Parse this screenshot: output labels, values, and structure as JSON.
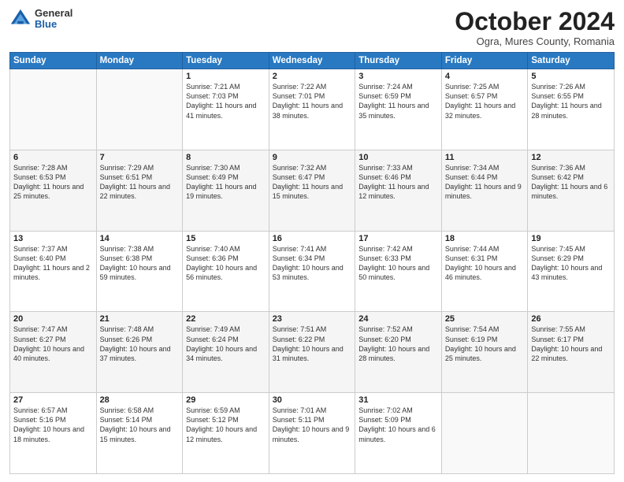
{
  "header": {
    "logo_general": "General",
    "logo_blue": "Blue",
    "month_title": "October 2024",
    "location": "Ogra, Mures County, Romania"
  },
  "days_of_week": [
    "Sunday",
    "Monday",
    "Tuesday",
    "Wednesday",
    "Thursday",
    "Friday",
    "Saturday"
  ],
  "weeks": [
    [
      {
        "day": "",
        "sunrise": "",
        "sunset": "",
        "daylight": ""
      },
      {
        "day": "",
        "sunrise": "",
        "sunset": "",
        "daylight": ""
      },
      {
        "day": "1",
        "sunrise": "Sunrise: 7:21 AM",
        "sunset": "Sunset: 7:03 PM",
        "daylight": "Daylight: 11 hours and 41 minutes."
      },
      {
        "day": "2",
        "sunrise": "Sunrise: 7:22 AM",
        "sunset": "Sunset: 7:01 PM",
        "daylight": "Daylight: 11 hours and 38 minutes."
      },
      {
        "day": "3",
        "sunrise": "Sunrise: 7:24 AM",
        "sunset": "Sunset: 6:59 PM",
        "daylight": "Daylight: 11 hours and 35 minutes."
      },
      {
        "day": "4",
        "sunrise": "Sunrise: 7:25 AM",
        "sunset": "Sunset: 6:57 PM",
        "daylight": "Daylight: 11 hours and 32 minutes."
      },
      {
        "day": "5",
        "sunrise": "Sunrise: 7:26 AM",
        "sunset": "Sunset: 6:55 PM",
        "daylight": "Daylight: 11 hours and 28 minutes."
      }
    ],
    [
      {
        "day": "6",
        "sunrise": "Sunrise: 7:28 AM",
        "sunset": "Sunset: 6:53 PM",
        "daylight": "Daylight: 11 hours and 25 minutes."
      },
      {
        "day": "7",
        "sunrise": "Sunrise: 7:29 AM",
        "sunset": "Sunset: 6:51 PM",
        "daylight": "Daylight: 11 hours and 22 minutes."
      },
      {
        "day": "8",
        "sunrise": "Sunrise: 7:30 AM",
        "sunset": "Sunset: 6:49 PM",
        "daylight": "Daylight: 11 hours and 19 minutes."
      },
      {
        "day": "9",
        "sunrise": "Sunrise: 7:32 AM",
        "sunset": "Sunset: 6:47 PM",
        "daylight": "Daylight: 11 hours and 15 minutes."
      },
      {
        "day": "10",
        "sunrise": "Sunrise: 7:33 AM",
        "sunset": "Sunset: 6:46 PM",
        "daylight": "Daylight: 11 hours and 12 minutes."
      },
      {
        "day": "11",
        "sunrise": "Sunrise: 7:34 AM",
        "sunset": "Sunset: 6:44 PM",
        "daylight": "Daylight: 11 hours and 9 minutes."
      },
      {
        "day": "12",
        "sunrise": "Sunrise: 7:36 AM",
        "sunset": "Sunset: 6:42 PM",
        "daylight": "Daylight: 11 hours and 6 minutes."
      }
    ],
    [
      {
        "day": "13",
        "sunrise": "Sunrise: 7:37 AM",
        "sunset": "Sunset: 6:40 PM",
        "daylight": "Daylight: 11 hours and 2 minutes."
      },
      {
        "day": "14",
        "sunrise": "Sunrise: 7:38 AM",
        "sunset": "Sunset: 6:38 PM",
        "daylight": "Daylight: 10 hours and 59 minutes."
      },
      {
        "day": "15",
        "sunrise": "Sunrise: 7:40 AM",
        "sunset": "Sunset: 6:36 PM",
        "daylight": "Daylight: 10 hours and 56 minutes."
      },
      {
        "day": "16",
        "sunrise": "Sunrise: 7:41 AM",
        "sunset": "Sunset: 6:34 PM",
        "daylight": "Daylight: 10 hours and 53 minutes."
      },
      {
        "day": "17",
        "sunrise": "Sunrise: 7:42 AM",
        "sunset": "Sunset: 6:33 PM",
        "daylight": "Daylight: 10 hours and 50 minutes."
      },
      {
        "day": "18",
        "sunrise": "Sunrise: 7:44 AM",
        "sunset": "Sunset: 6:31 PM",
        "daylight": "Daylight: 10 hours and 46 minutes."
      },
      {
        "day": "19",
        "sunrise": "Sunrise: 7:45 AM",
        "sunset": "Sunset: 6:29 PM",
        "daylight": "Daylight: 10 hours and 43 minutes."
      }
    ],
    [
      {
        "day": "20",
        "sunrise": "Sunrise: 7:47 AM",
        "sunset": "Sunset: 6:27 PM",
        "daylight": "Daylight: 10 hours and 40 minutes."
      },
      {
        "day": "21",
        "sunrise": "Sunrise: 7:48 AM",
        "sunset": "Sunset: 6:26 PM",
        "daylight": "Daylight: 10 hours and 37 minutes."
      },
      {
        "day": "22",
        "sunrise": "Sunrise: 7:49 AM",
        "sunset": "Sunset: 6:24 PM",
        "daylight": "Daylight: 10 hours and 34 minutes."
      },
      {
        "day": "23",
        "sunrise": "Sunrise: 7:51 AM",
        "sunset": "Sunset: 6:22 PM",
        "daylight": "Daylight: 10 hours and 31 minutes."
      },
      {
        "day": "24",
        "sunrise": "Sunrise: 7:52 AM",
        "sunset": "Sunset: 6:20 PM",
        "daylight": "Daylight: 10 hours and 28 minutes."
      },
      {
        "day": "25",
        "sunrise": "Sunrise: 7:54 AM",
        "sunset": "Sunset: 6:19 PM",
        "daylight": "Daylight: 10 hours and 25 minutes."
      },
      {
        "day": "26",
        "sunrise": "Sunrise: 7:55 AM",
        "sunset": "Sunset: 6:17 PM",
        "daylight": "Daylight: 10 hours and 22 minutes."
      }
    ],
    [
      {
        "day": "27",
        "sunrise": "Sunrise: 6:57 AM",
        "sunset": "Sunset: 5:16 PM",
        "daylight": "Daylight: 10 hours and 18 minutes."
      },
      {
        "day": "28",
        "sunrise": "Sunrise: 6:58 AM",
        "sunset": "Sunset: 5:14 PM",
        "daylight": "Daylight: 10 hours and 15 minutes."
      },
      {
        "day": "29",
        "sunrise": "Sunrise: 6:59 AM",
        "sunset": "Sunset: 5:12 PM",
        "daylight": "Daylight: 10 hours and 12 minutes."
      },
      {
        "day": "30",
        "sunrise": "Sunrise: 7:01 AM",
        "sunset": "Sunset: 5:11 PM",
        "daylight": "Daylight: 10 hours and 9 minutes."
      },
      {
        "day": "31",
        "sunrise": "Sunrise: 7:02 AM",
        "sunset": "Sunset: 5:09 PM",
        "daylight": "Daylight: 10 hours and 6 minutes."
      },
      {
        "day": "",
        "sunrise": "",
        "sunset": "",
        "daylight": ""
      },
      {
        "day": "",
        "sunrise": "",
        "sunset": "",
        "daylight": ""
      }
    ]
  ]
}
